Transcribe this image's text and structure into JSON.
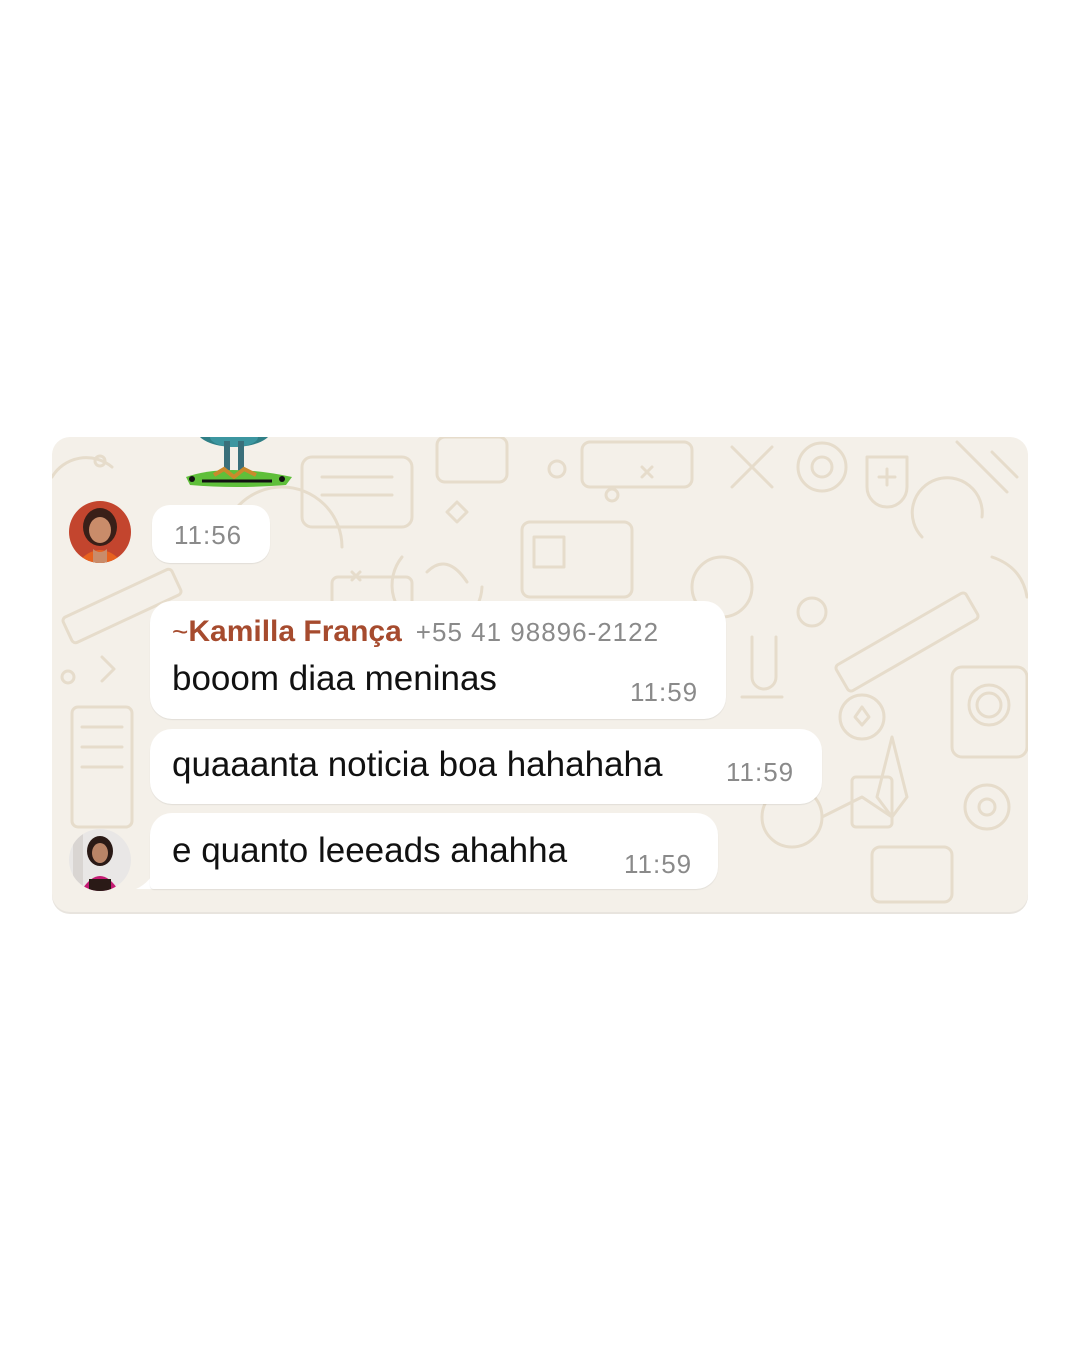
{
  "chat": {
    "messages": [
      {
        "type": "sticker",
        "time": "11:56",
        "sender_avatar": "avatar-woman-orange"
      },
      {
        "type": "text",
        "sender": {
          "tilde": "~",
          "name": "Kamilla França",
          "phone": "+55 41 98896-2122"
        },
        "text": "booom diaa meninas",
        "time": "11:59"
      },
      {
        "type": "text",
        "text": "quaaanta noticia boa hahahaha",
        "time": "11:59"
      },
      {
        "type": "text",
        "text": "e quanto leeeads ahahha",
        "time": "11:59",
        "sender_avatar": "avatar-woman-pink"
      }
    ]
  },
  "colors": {
    "wallpaper": "#f4f0e9",
    "bubble": "#ffffff",
    "sender_name": "#a64b2e",
    "timestamp": "#8a8a8a"
  }
}
